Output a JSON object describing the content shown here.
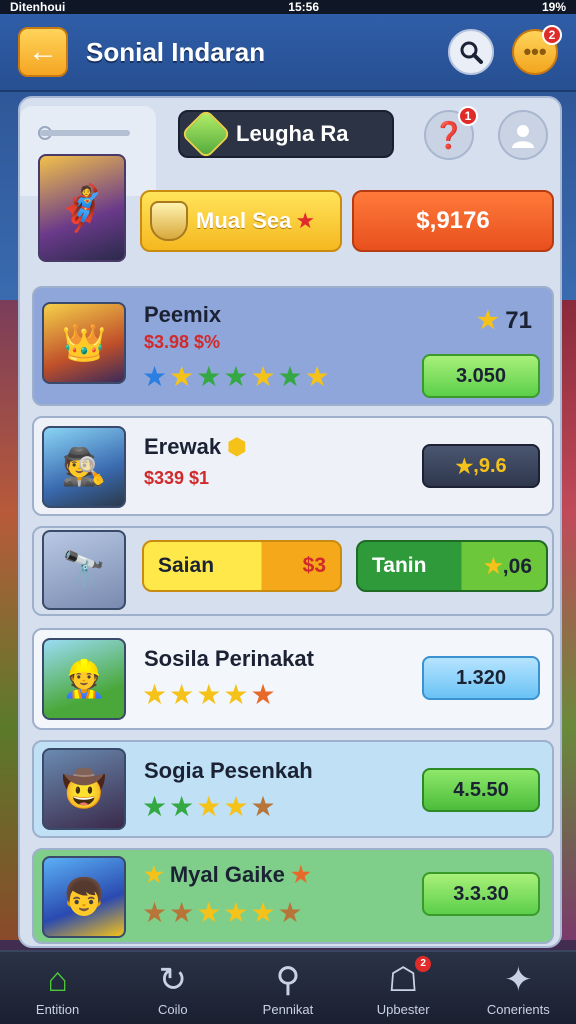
{
  "status": {
    "left": "Ditenhoui",
    "time": "15:56",
    "battery": "19%"
  },
  "header": {
    "title": "Sonial Indaran",
    "back_icon": "arrow-left-icon",
    "notification_count": "2"
  },
  "league": {
    "label": "Leugha Ra",
    "hint_count": "1"
  },
  "top_row": {
    "vip_label": "Mual Sea",
    "price": "$,9176"
  },
  "cards": [
    {
      "name": "Peemix",
      "sub": "$3.98 $%",
      "rating": "71",
      "value": "3.050"
    },
    {
      "name": "Erewak",
      "sub": "$339 $1",
      "value": "9.6"
    },
    {
      "sale_label": "Saian",
      "sale_price": "$3",
      "tenin_label": "Tanin",
      "tenin_value": "06"
    },
    {
      "name": "Sosila Perinakat",
      "value": "1.320"
    },
    {
      "name": "Sogia Pesenkah",
      "value": "4.5.50"
    },
    {
      "name": "Myal Gaike",
      "value": "3.3.30"
    }
  ],
  "nav": [
    {
      "label": "Entition",
      "icon": "home-icon"
    },
    {
      "label": "Coilo",
      "icon": "refresh-icon"
    },
    {
      "label": "Pennikat",
      "icon": "search-icon"
    },
    {
      "label": "Upbester",
      "icon": "shop-icon",
      "badge": "2"
    },
    {
      "label": "Conerients",
      "icon": "achievement-icon"
    }
  ]
}
